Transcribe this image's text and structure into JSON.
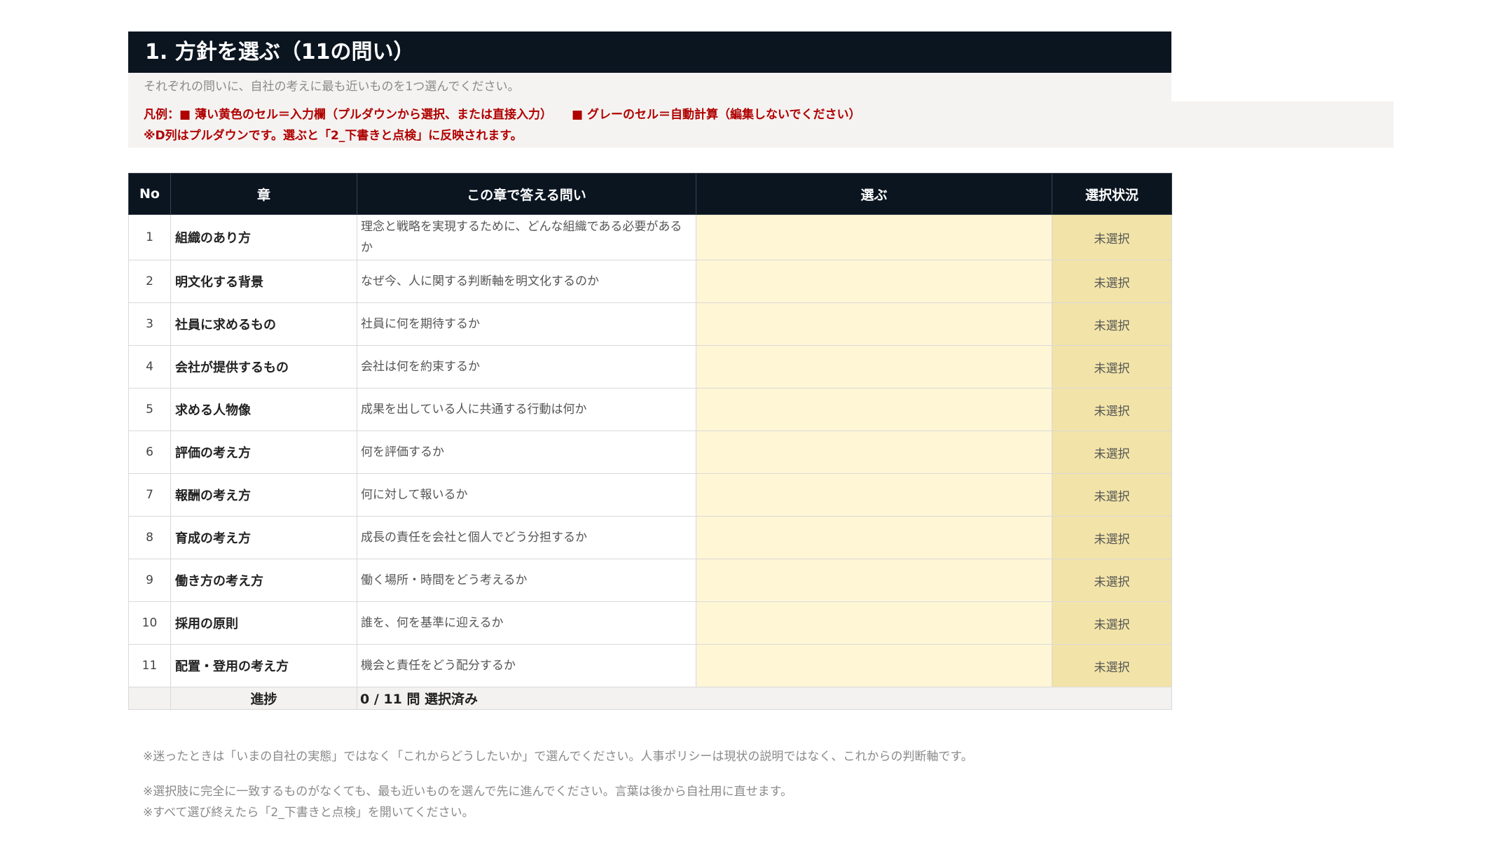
{
  "title": "1. 方針を選ぶ（11の問い）",
  "intro": "それぞれの問いに、自社の考えに最も近いものを1つ選んでください。",
  "legend": {
    "prefix": "凡例：",
    "yellow": "■ 薄い黄色のセル＝入力欄（プルダウンから選択、または直接入力）",
    "gray": "■ グレーのセル＝自動計算（編集しないでください）",
    "line2": "※D列はプルダウンです。選ぶと「2_下書きと点検」に反映されます。"
  },
  "colors": {
    "header_bg": "#0a1520",
    "input_cell": "#fff6d6",
    "status_cell": "#f2e4a8",
    "legend_text": "#b00000"
  },
  "table": {
    "headers": {
      "no": "No",
      "chapter": "章",
      "question": "この章で答える問い",
      "pick": "選ぶ",
      "status": "選択状況"
    },
    "rows": [
      {
        "no": "1",
        "chapter": "組織のあり方",
        "question": "理念と戦略を実現するために、どんな組織である必要があるか",
        "pick": "",
        "status": "未選択"
      },
      {
        "no": "2",
        "chapter": "明文化する背景",
        "question": "なぜ今、人に関する判断軸を明文化するのか",
        "pick": "",
        "status": "未選択"
      },
      {
        "no": "3",
        "chapter": "社員に求めるもの",
        "question": "社員に何を期待するか",
        "pick": "",
        "status": "未選択"
      },
      {
        "no": "4",
        "chapter": "会社が提供するもの",
        "question": "会社は何を約束するか",
        "pick": "",
        "status": "未選択"
      },
      {
        "no": "5",
        "chapter": "求める人物像",
        "question": "成果を出している人に共通する行動は何か",
        "pick": "",
        "status": "未選択"
      },
      {
        "no": "6",
        "chapter": "評価の考え方",
        "question": "何を評価するか",
        "pick": "",
        "status": "未選択"
      },
      {
        "no": "7",
        "chapter": "報酬の考え方",
        "question": "何に対して報いるか",
        "pick": "",
        "status": "未選択"
      },
      {
        "no": "8",
        "chapter": "育成の考え方",
        "question": "成長の責任を会社と個人でどう分担するか",
        "pick": "",
        "status": "未選択"
      },
      {
        "no": "9",
        "chapter": "働き方の考え方",
        "question": "働く場所・時間をどう考えるか",
        "pick": "",
        "status": "未選択"
      },
      {
        "no": "10",
        "chapter": "採用の原則",
        "question": "誰を、何を基準に迎えるか",
        "pick": "",
        "status": "未選択"
      },
      {
        "no": "11",
        "chapter": "配置・登用の考え方",
        "question": "機会と責任をどう配分するか",
        "pick": "",
        "status": "未選択"
      }
    ],
    "progress": {
      "label": "進捗",
      "value": "0 / 11 問 選択済み"
    }
  },
  "notes": [
    "※迷ったときは「いまの自社の実態」ではなく「これからどうしたいか」で選んでください。人事ポリシーは現状の説明ではなく、これからの判断軸です。",
    "※選択肢に完全に一致するものがなくても、最も近いものを選んで先に進んでください。言葉は後から自社用に直せます。",
    "※すべて選び終えたら「2_下書きと点検」を開いてください。"
  ]
}
